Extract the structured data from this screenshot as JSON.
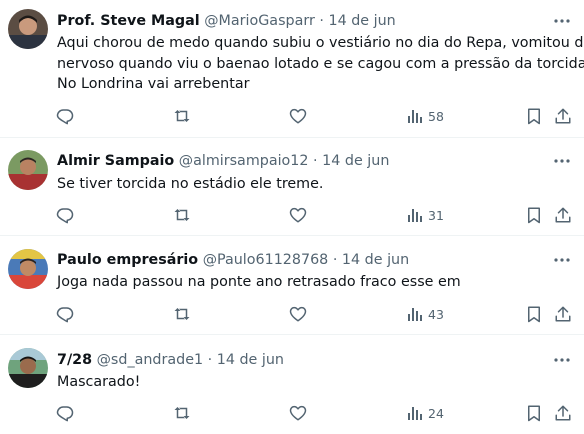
{
  "tweets": [
    {
      "name": "Prof. Steve Magal",
      "handle": "@MarioGasparr",
      "separator": "·",
      "date": "14 de jun",
      "lines": [
        "Aqui chorou de medo quando subiu o vestiário no dia do Repa, vomitou de",
        "nervoso quando viu o baenao lotado e se cagou com a pressão da torcida.",
        "No Londrina vai arrebentar"
      ],
      "views": "58"
    },
    {
      "name": "Almir Sampaio",
      "handle": "@almirsampaio12",
      "separator": "·",
      "date": "14 de jun",
      "lines": [
        "Se tiver torcida no estádio ele treme."
      ],
      "views": "31"
    },
    {
      "name": "Paulo empresário",
      "handle": "@Paulo61128768",
      "separator": "·",
      "date": "14 de jun",
      "lines": [
        "Joga nada passou na ponte ano retrasado fraco esse em"
      ],
      "views": "43"
    },
    {
      "name": "7/28",
      "handle": "@sd_andrade1",
      "separator": "·",
      "date": "14 de jun",
      "lines": [
        "Mascarado!"
      ],
      "views": "24"
    }
  ],
  "icons": {
    "reply": "reply-icon",
    "retweet": "retweet-icon",
    "like": "like-icon",
    "views": "views-icon",
    "bookmark": "bookmark-icon",
    "share": "share-icon",
    "more": "more-icon"
  },
  "colors": {
    "text": "#0f1419",
    "secondary": "#536471",
    "divider": "#eff3f4"
  }
}
